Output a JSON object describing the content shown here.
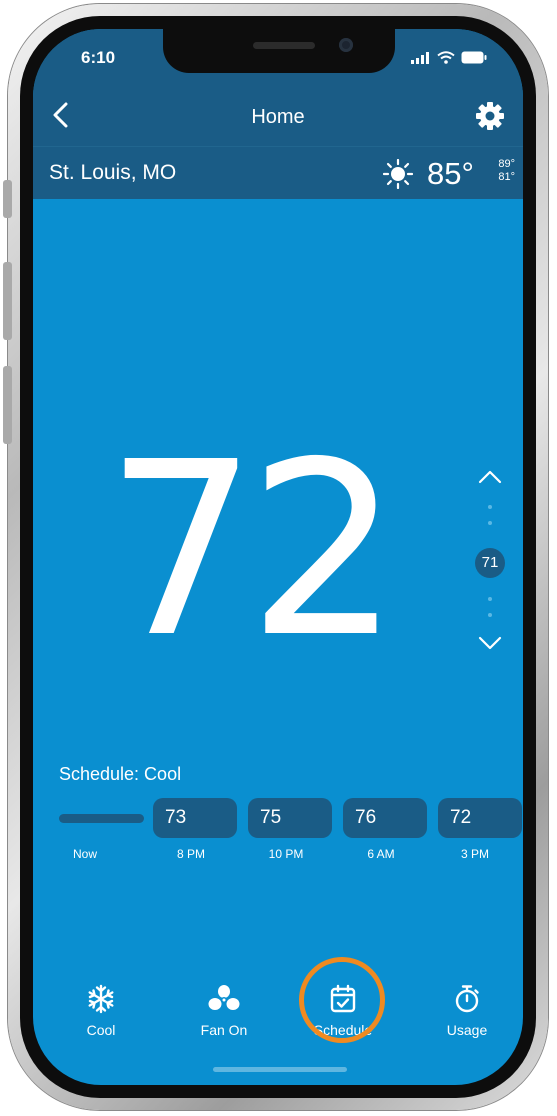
{
  "status_bar": {
    "time": "6:10"
  },
  "nav": {
    "title": "Home",
    "back_icon": "chevron-left-icon",
    "settings_icon": "gear-icon"
  },
  "weather": {
    "location": "St. Louis, MO",
    "icon": "sun-icon",
    "current": "85°",
    "high": "89°",
    "low": "81°"
  },
  "thermostat": {
    "current_temp": "72",
    "setpoint": "71"
  },
  "schedule": {
    "label": "Schedule: Cool",
    "now_label": "Now",
    "entries": [
      {
        "temp": "73",
        "time": "8 PM"
      },
      {
        "temp": "75",
        "time": "10 PM"
      },
      {
        "temp": "76",
        "time": "6 AM"
      },
      {
        "temp": "72",
        "time": "3 PM"
      }
    ]
  },
  "tabs": [
    {
      "label": "Cool",
      "icon": "snowflake-icon"
    },
    {
      "label": "Fan On",
      "icon": "fan-icon"
    },
    {
      "label": "Schedule",
      "icon": "calendar-check-icon"
    },
    {
      "label": "Usage",
      "icon": "stopwatch-icon"
    }
  ],
  "colors": {
    "background": "#0a8fd0",
    "header": "#1a5c86",
    "highlight_ring": "#ef8a21"
  }
}
